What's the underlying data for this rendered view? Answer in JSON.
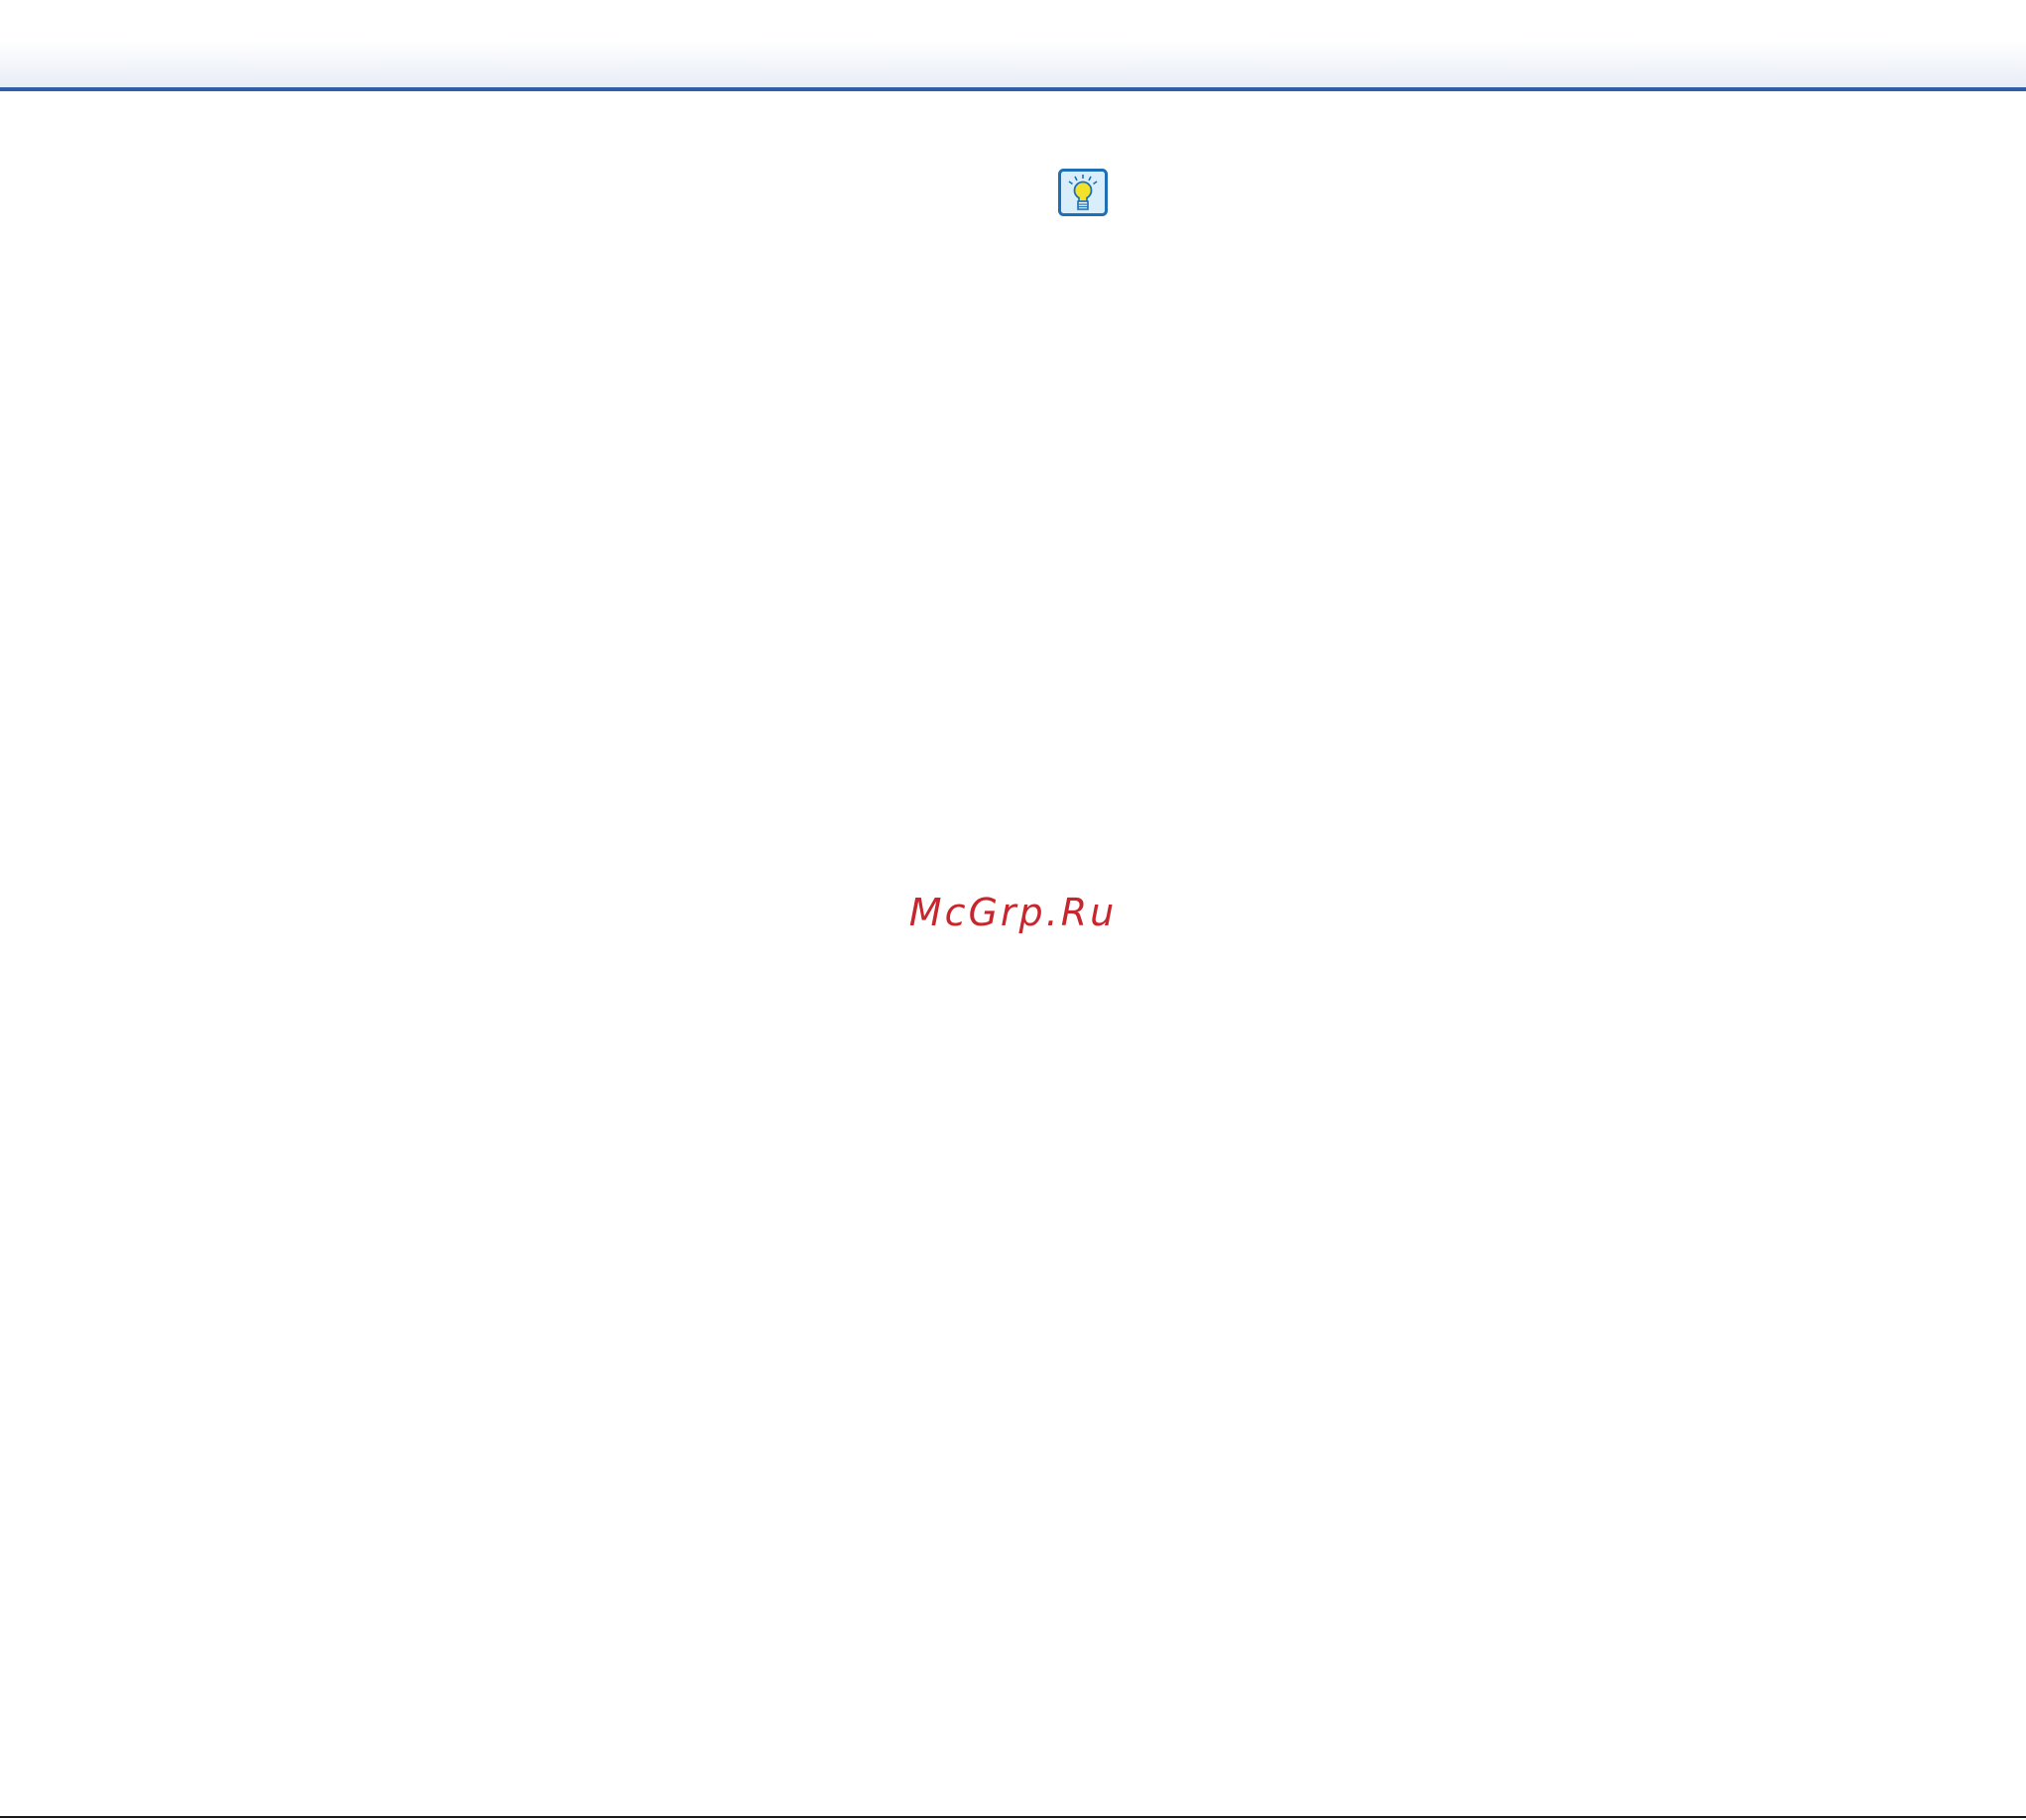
{
  "page": {
    "watermark": "McGrp.Ru"
  },
  "icons": {
    "hint": "lightbulb-icon"
  },
  "colors": {
    "header_rule": "#2f5ea8",
    "icon_border": "#1f6fb6",
    "icon_background": "#d8eefb",
    "bulb": "#f2e32a",
    "watermark": "#c8262e"
  }
}
